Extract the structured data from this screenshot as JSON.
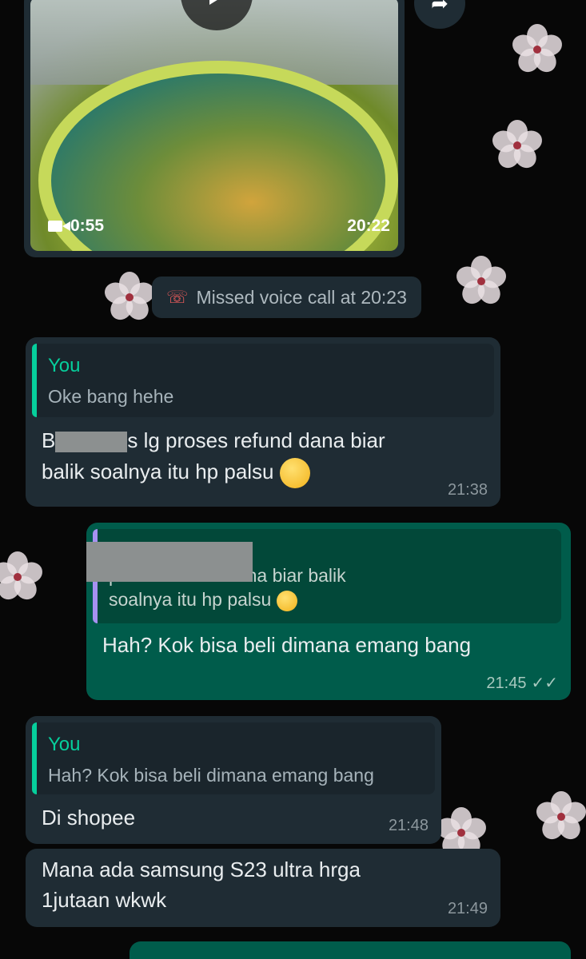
{
  "video_message": {
    "duration": "0:55",
    "time": "20:22"
  },
  "missed_call": {
    "text": "Missed voice call at 20:23"
  },
  "messages": [
    {
      "direction": "incoming",
      "quote_author": "You",
      "quote_text": "Oke bang hehe",
      "text_line1_start": "B",
      "text_line1_end": "s lg proses refund dana biar",
      "text_line2": "balik soalnya itu hp palsu",
      "emoji": "rolling-on-floor-laughing",
      "time": "21:38"
    },
    {
      "direction": "outgoing",
      "quote_line1": "proses refund dana biar balik",
      "quote_line2": "soalnya itu hp palsu",
      "emoji": "rolling-on-floor-laughing",
      "text": "Hah? Kok bisa beli dimana emang bang",
      "time": "21:45",
      "status": "read"
    },
    {
      "direction": "incoming",
      "quote_author": "You",
      "quote_text": "Hah? Kok bisa beli dimana emang bang",
      "text": "Di shopee",
      "time": "21:48"
    },
    {
      "direction": "incoming",
      "text_line1": "Mana ada samsung S23 ultra hrga",
      "text_line2": "1jutaan wkwk",
      "time": "21:49"
    }
  ],
  "colors": {
    "incoming_bubble": "#1f2c34",
    "outgoing_bubble": "#005c4b",
    "quote_accent": "#06cf9c",
    "missed_call_icon": "#ea5b5b",
    "read_ticks": "#a8c9bf"
  }
}
